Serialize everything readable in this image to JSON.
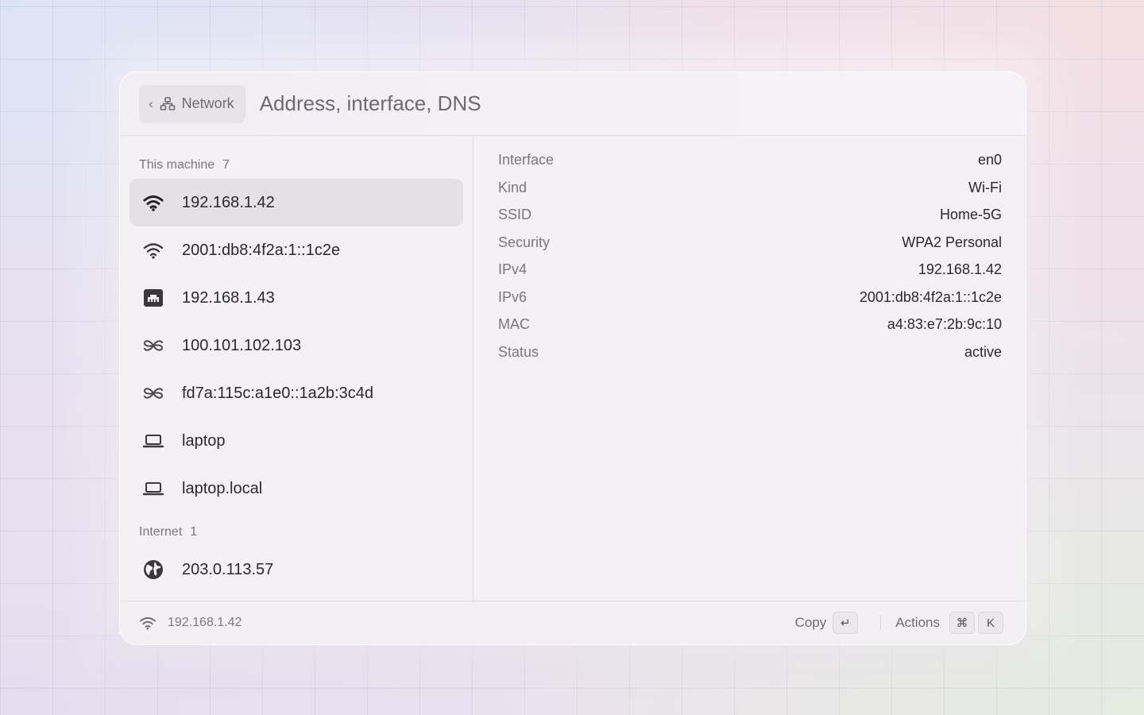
{
  "header": {
    "back_label": "Network",
    "title": "Address, interface, DNS"
  },
  "sidebar": {
    "groups": [
      {
        "label": "This machine",
        "count": "7",
        "items": [
          {
            "label": "192.168.1.42",
            "icon": "wifi-icon",
            "selected": true
          },
          {
            "label": "2001:db8:4f2a:1::1c2e",
            "icon": "wifi-icon"
          },
          {
            "label": "192.168.1.43",
            "icon": "ethernet-icon"
          },
          {
            "label": "100.101.102.103",
            "icon": "tailscale-icon"
          },
          {
            "label": "fd7a:115c:a1e0::1a2b:3c4d",
            "icon": "tailscale-icon"
          },
          {
            "label": "laptop",
            "icon": "laptop-icon"
          },
          {
            "label": "laptop.local",
            "icon": "laptop-icon"
          }
        ]
      },
      {
        "label": "Internet",
        "count": "1",
        "items": [
          {
            "label": "203.0.113.57",
            "icon": "globe-icon"
          }
        ]
      }
    ]
  },
  "details": [
    {
      "key": "Interface",
      "value": "en0"
    },
    {
      "key": "Kind",
      "value": "Wi-Fi"
    },
    {
      "key": "SSID",
      "value": "Home-5G"
    },
    {
      "key": "Security",
      "value": "WPA2 Personal"
    },
    {
      "key": "IPv4",
      "value": "192.168.1.42"
    },
    {
      "key": "IPv6",
      "value": "2001:db8:4f2a:1::1c2e"
    },
    {
      "key": "MAC",
      "value": "a4:83:e7:2b:9c:10"
    },
    {
      "key": "Status",
      "value": "active"
    }
  ],
  "footer": {
    "status_text": "192.168.1.42",
    "copy_label": "Copy",
    "copy_key": "↵",
    "actions_label": "Actions",
    "actions_keys": [
      "⌘",
      "K"
    ]
  }
}
